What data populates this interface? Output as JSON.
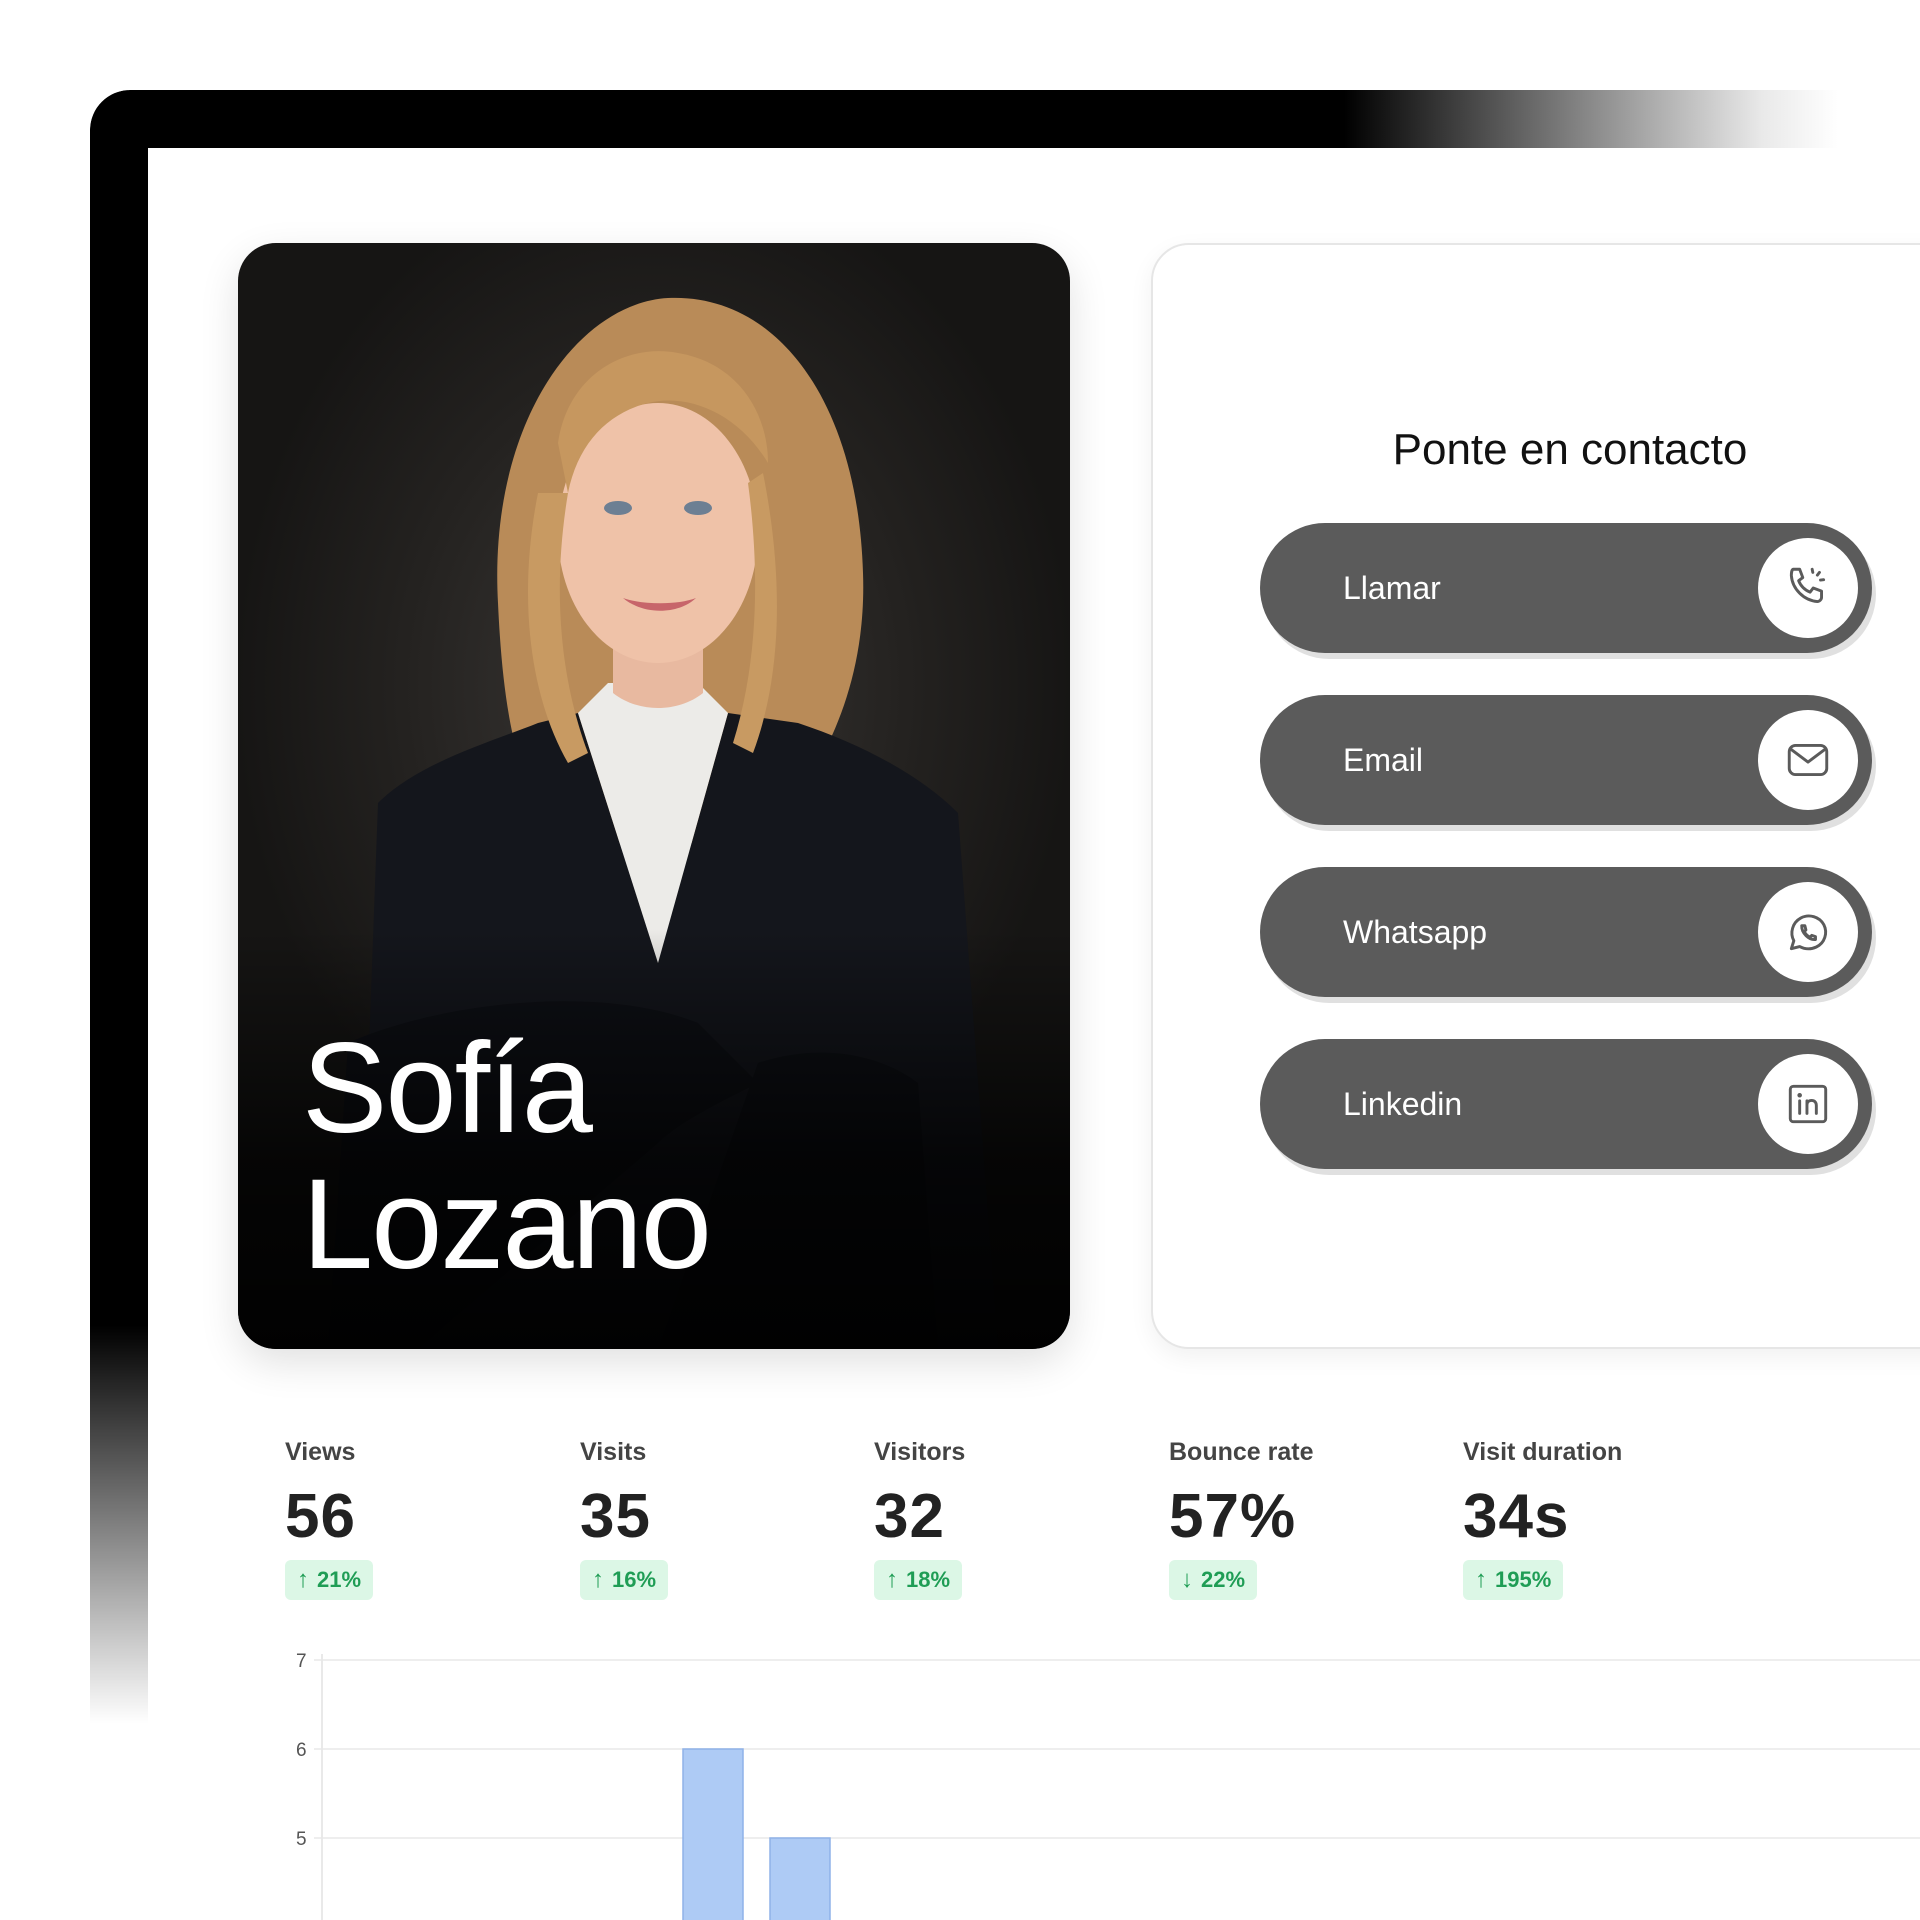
{
  "profile": {
    "first_name": "Sofía",
    "last_name": "Lozano"
  },
  "contact": {
    "title": "Ponte en contacto",
    "buttons": [
      {
        "label": "Llamar",
        "icon": "phone-icon"
      },
      {
        "label": "Email",
        "icon": "mail-icon"
      },
      {
        "label": "Whatsapp",
        "icon": "whatsapp-icon"
      },
      {
        "label": "Linkedin",
        "icon": "linkedin-icon"
      }
    ]
  },
  "stats": [
    {
      "label": "Views",
      "value": "56",
      "change": "21%",
      "direction": "up"
    },
    {
      "label": "Visits",
      "value": "35",
      "change": "16%",
      "direction": "up"
    },
    {
      "label": "Visitors",
      "value": "32",
      "change": "18%",
      "direction": "up"
    },
    {
      "label": "Bounce rate",
      "value": "57%",
      "change": "22%",
      "direction": "down"
    },
    {
      "label": "Visit duration",
      "value": "34s",
      "change": "195%",
      "direction": "up"
    }
  ],
  "colors": {
    "button_bg": "#5b5b5b",
    "badge_bg": "#dcf7e6",
    "badge_text": "#1f9d55",
    "bar_fill": "#aecbf5",
    "bar_stroke": "#8fb2e8"
  },
  "chart_data": {
    "type": "bar",
    "y_ticks": [
      "7",
      "6",
      "5"
    ],
    "ylim": [
      4,
      7
    ],
    "grid": true,
    "visible_bars": [
      {
        "value": 6
      },
      {
        "value": 5
      }
    ]
  }
}
